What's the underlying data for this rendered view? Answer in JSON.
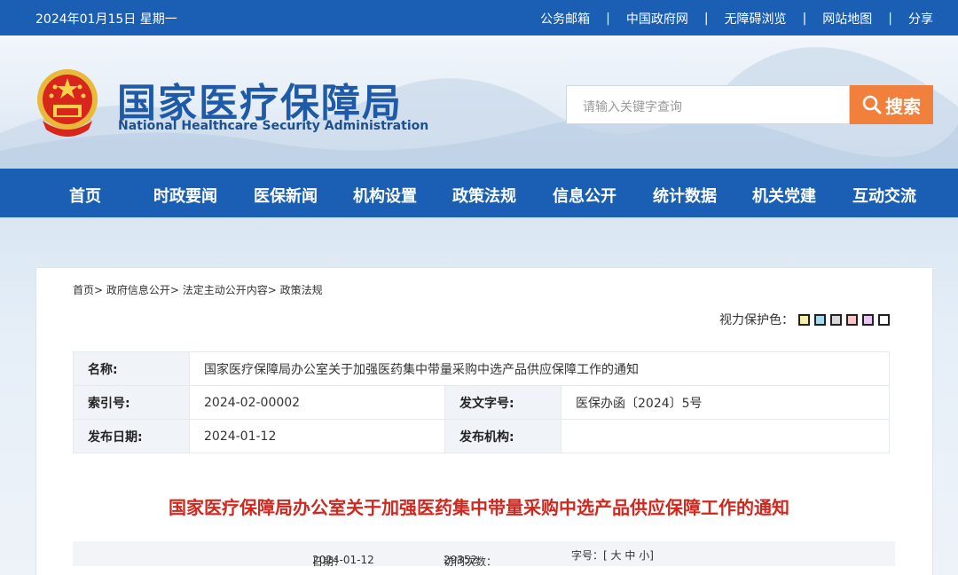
{
  "topbar": {
    "date": "2024年01月15日 星期一",
    "links": [
      "公务邮箱",
      "中国政府网",
      "无障碍浏览",
      "网站地图",
      "分享"
    ],
    "separator": "|"
  },
  "header": {
    "emblem_icon": "national-emblem-icon",
    "logo_cn": "国家医疗保障局",
    "logo_en": "National Healthcare Security Administration",
    "search_placeholder": "请输入关键字查询",
    "search_button": "搜索",
    "search_icon": "search-icon",
    "search_color": "#f0803c"
  },
  "nav": {
    "items": [
      "首页",
      "时政要闻",
      "医保新闻",
      "机构设置",
      "政策法规",
      "信息公开",
      "统计数据",
      "机关党建",
      "互动交流"
    ],
    "color": "#1a5fb4"
  },
  "breadcrumb": [
    "首页>",
    "政府信息公开>",
    "法定主动公开内容>",
    "政策法规"
  ],
  "eyecare": {
    "label": "视力保护色：",
    "colors": [
      "#f5efa8",
      "#a8d8ee",
      "#d7d7d7",
      "#f6c6c6",
      "#e7c6ef",
      "#ffffff"
    ]
  },
  "meta": {
    "name_label": "名称:",
    "name_value": "国家医疗保障局办公室关于加强医药集中带量采购中选产品供应保障工作的通知",
    "index_label": "索引号:",
    "index_value": "2024-02-00002",
    "docno_label": "发文字号:",
    "docno_value": "医保办函〔2024〕5号",
    "date_label": "发布日期:",
    "date_value": "2024-01-12",
    "org_label": "发布机构:",
    "org_value": ""
  },
  "article": {
    "title": "国家医疗保障局办公室关于加强医药集中带量采购中选产品供应保障工作的通知",
    "date_label": "日期：",
    "date_value": "2024-01-12",
    "visits_label": "访问次数：",
    "visits_value": "29352",
    "fontsize_label": "字号：",
    "size_open": "[",
    "size_big": "大",
    "size_mid": "中",
    "size_small": "小",
    "size_close": "]",
    "title_color": "#d0281f"
  }
}
